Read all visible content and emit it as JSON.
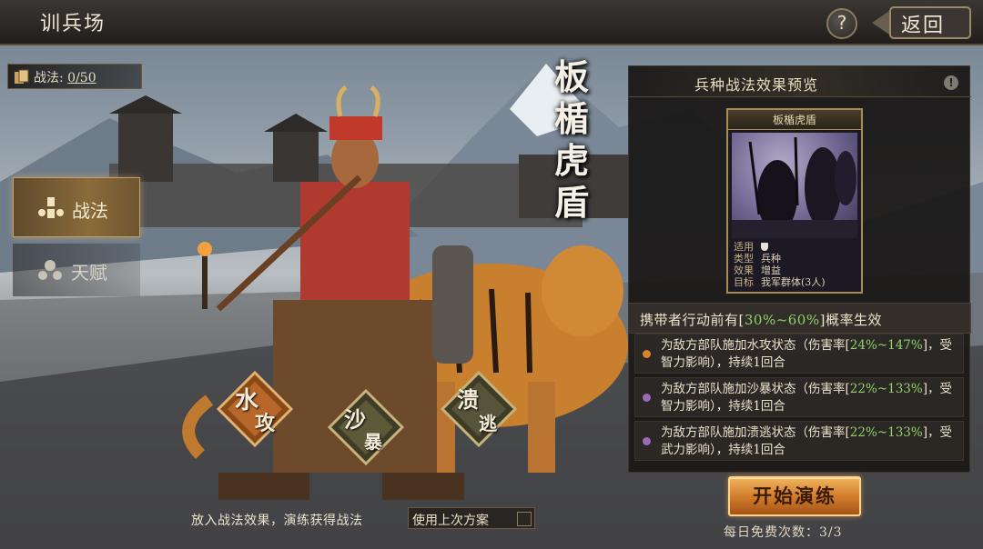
{
  "header": {
    "title": "训兵场",
    "help_label": "?",
    "back_label": "返回"
  },
  "tactics_count": {
    "label": "战法:",
    "value": "0/50"
  },
  "side_tabs": [
    {
      "label": "战法",
      "icon": "tactic-icon",
      "selected": true
    },
    {
      "label": "天赋",
      "icon": "talent-icon",
      "selected": false
    }
  ],
  "unit": {
    "name_vertical": [
      "板",
      "楯",
      "虎",
      "盾"
    ]
  },
  "skill_badges": [
    {
      "top": "水",
      "bottom": "攻",
      "color": "#c8742a"
    },
    {
      "top": "沙",
      "bottom": "暴",
      "color": "#6b6a3c"
    },
    {
      "top": "溃",
      "bottom": "逃",
      "color": "#5b5a3a"
    }
  ],
  "panel": {
    "title": "兵种战法效果预览",
    "info_icon": "!",
    "card": {
      "name": "板楯虎盾",
      "rows": [
        {
          "key": "适用",
          "value": ""
        },
        {
          "key": "类型",
          "value": "兵种"
        },
        {
          "key": "效果",
          "value": "增益"
        },
        {
          "key": "目标",
          "value": "我军群体(3人)"
        }
      ]
    },
    "condition": {
      "prefix": "携带者行动前有[",
      "highlight": "30%~60%",
      "suffix": "]概率生效"
    },
    "effects": [
      {
        "dot_color": "#d9852a",
        "text_a": "为敌方部队施加水攻状态（伤害率[",
        "hl_a": "24%",
        "text_b": "",
        "hl_b": "~147%",
        "text_c": "]，受智力影响），持续1回合"
      },
      {
        "dot_color": "#9a6bb8",
        "text_a": "为敌方部队施加沙暴状态（伤害率[",
        "hl_a": "22%",
        "text_b": "",
        "hl_b": "~133%",
        "text_c": "]，受智力影响），持续1回合"
      },
      {
        "dot_color": "#9a6bb8",
        "text_a": "为敌方部队施加溃逃状态（伤害率[",
        "hl_a": "22%",
        "text_b": "",
        "hl_b": "~133%",
        "text_c": "]，受武力影响），持续1回合"
      }
    ]
  },
  "start_button": {
    "label": "开始演练"
  },
  "free_count": {
    "label": "每日免费次数：",
    "value": "3/3"
  },
  "bottom_hint": "放入战法效果，演练获得战法",
  "reuse": {
    "label": "使用上次方案",
    "checked": false
  }
}
